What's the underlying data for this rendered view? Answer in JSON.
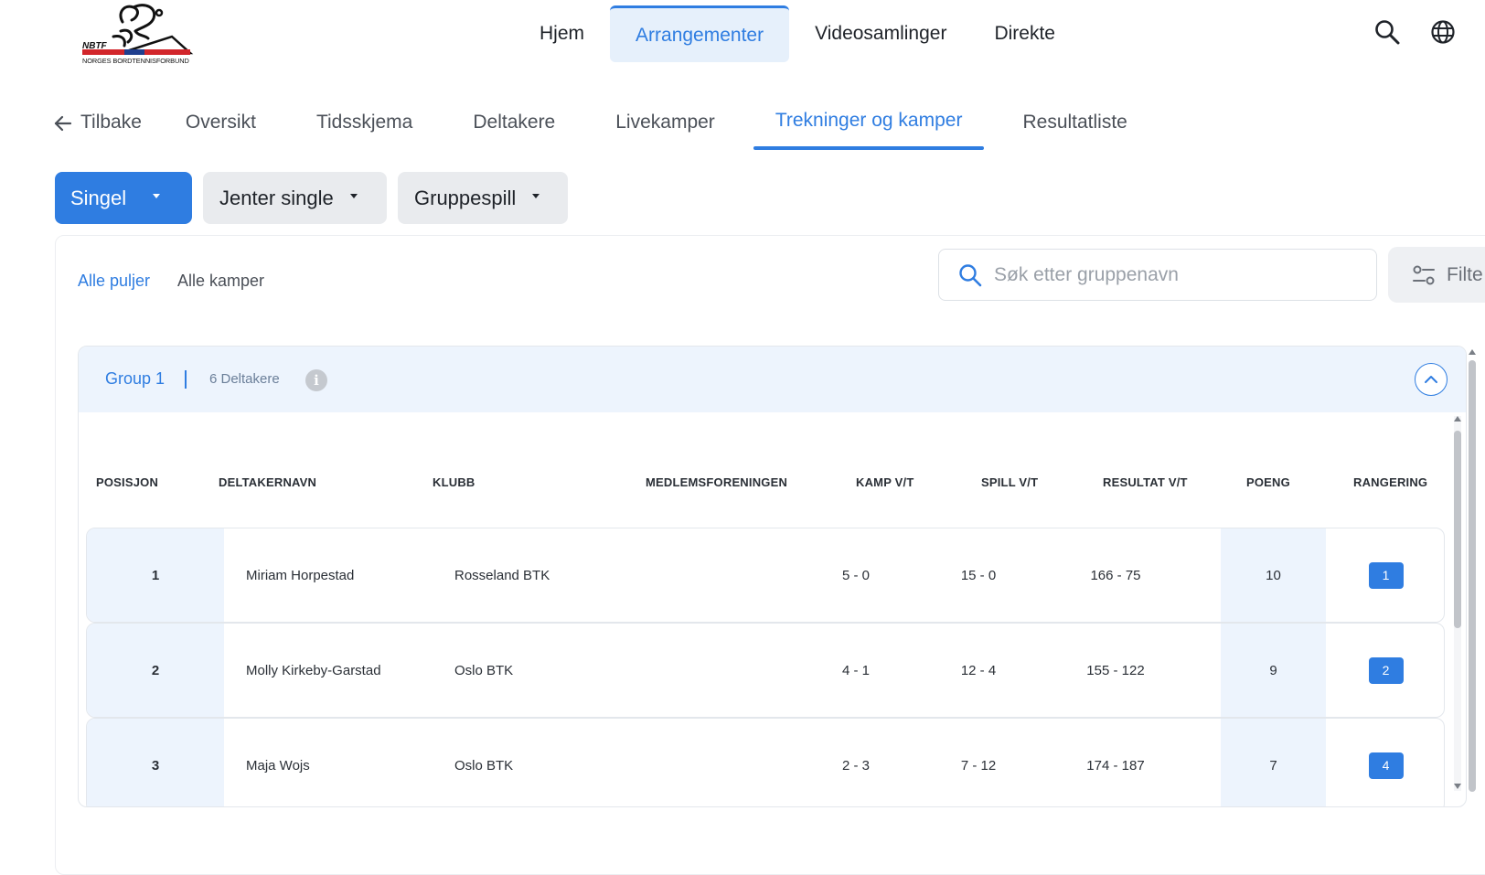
{
  "brand": {
    "short": "NBTF",
    "full": "NORGES BORDTENNISFORBUND",
    "accent": "#2f7de1"
  },
  "nav": {
    "items": [
      {
        "label": "Hjem",
        "active": false
      },
      {
        "label": "Arrangementer",
        "active": true
      },
      {
        "label": "Videosamlinger",
        "active": false
      },
      {
        "label": "Direkte",
        "active": false
      }
    ],
    "icons": [
      "search-icon",
      "globe-icon"
    ]
  },
  "subnav": {
    "back_label": "Tilbake",
    "tabs": [
      {
        "label": "Oversikt",
        "active": false
      },
      {
        "label": "Tidsskjema",
        "active": false
      },
      {
        "label": "Deltakere",
        "active": false
      },
      {
        "label": "Livekamper",
        "active": false
      },
      {
        "label": "Trekninger og kamper",
        "active": true
      },
      {
        "label": "Resultatliste",
        "active": false
      }
    ]
  },
  "filters": {
    "type": "Singel",
    "class": "Jenter single",
    "stage": "Gruppespill"
  },
  "view_tabs": {
    "groups": "Alle puljer",
    "matches": "Alle kamper",
    "active": "groups"
  },
  "search": {
    "placeholder": "Søk etter gruppenavn",
    "value": ""
  },
  "filter_button": {
    "label": "Filte"
  },
  "group": {
    "title": "Group 1",
    "count_label": "6 Deltakere",
    "info_glyph": "i",
    "expanded": true,
    "columns": [
      "POSISJON",
      "DELTAKERNAVN",
      "KLUBB",
      "MEDLEMSFORENINGEN",
      "KAMP V/T",
      "SPILL V/T",
      "RESULTAT V/T",
      "POENG",
      "RANGERING"
    ],
    "rows": [
      {
        "pos": "1",
        "name": "Miriam Horpestad",
        "club": "Rosseland BTK",
        "association": "",
        "kamp": "5 - 0",
        "spill": "15 - 0",
        "result": "166 - 75",
        "points": "10",
        "rank": "1"
      },
      {
        "pos": "2",
        "name": "Molly Kirkeby-Garstad",
        "club": "Oslo BTK",
        "association": "",
        "kamp": "4 - 1",
        "spill": "12 - 4",
        "result": "155 - 122",
        "points": "9",
        "rank": "2"
      },
      {
        "pos": "3",
        "name": "Maja Wojs",
        "club": "Oslo BTK",
        "association": "",
        "kamp": "2 - 3",
        "spill": "7 - 12",
        "result": "174 - 187",
        "points": "7",
        "rank": "4"
      }
    ]
  }
}
